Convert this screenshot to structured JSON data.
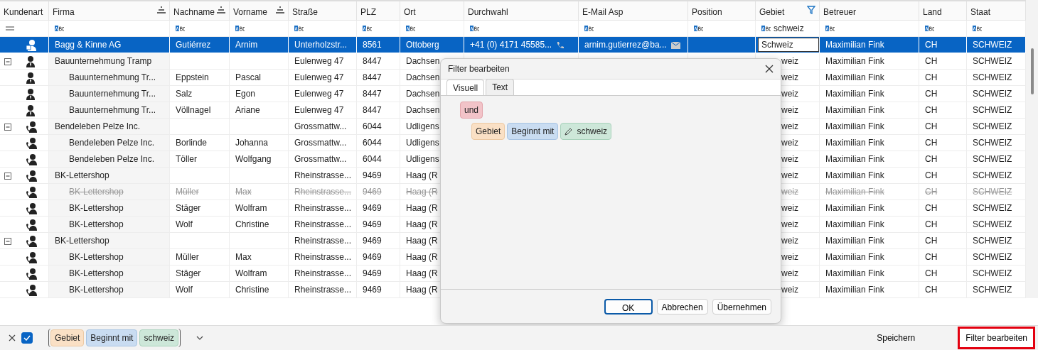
{
  "columns": [
    {
      "label": "Kundenart",
      "sorted": false,
      "filtered": false
    },
    {
      "label": "Firma",
      "sorted": true,
      "filtered": false
    },
    {
      "label": "Nachname",
      "sorted": true,
      "filtered": false
    },
    {
      "label": "Vorname",
      "sorted": true,
      "filtered": false
    },
    {
      "label": "Straße",
      "sorted": false,
      "filtered": false
    },
    {
      "label": "PLZ",
      "sorted": false,
      "filtered": false
    },
    {
      "label": "Ort",
      "sorted": false,
      "filtered": false
    },
    {
      "label": "Durchwahl",
      "sorted": false,
      "filtered": false
    },
    {
      "label": "E-Mail Asp",
      "sorted": false,
      "filtered": false
    },
    {
      "label": "Position",
      "sorted": false,
      "filtered": false
    },
    {
      "label": "Gebiet",
      "sorted": false,
      "filtered": true,
      "filter_text": "schweiz"
    },
    {
      "label": "Betreuer",
      "sorted": false,
      "filtered": false
    },
    {
      "label": "Land",
      "sorted": false,
      "filtered": false
    },
    {
      "label": "Staat",
      "sorted": false,
      "filtered": false
    }
  ],
  "rows": [
    {
      "kind": "company",
      "selected": true,
      "deleted": false,
      "firma": "Bagg & Kinne AG",
      "nachname": "Gutiérrez",
      "vorname": "Arnim",
      "strasse": "Unterholzstr...",
      "plz": "8561",
      "ort": "Ottoberg",
      "durchwahl": "+41 (0) 4171 45585...",
      "email": "arnim.gutierrez@ba...",
      "gebiet": "Schweiz",
      "betreuer": "Maximilian Fink",
      "land": "CH",
      "staat": "SCHWEIZ"
    },
    {
      "kind": "person",
      "selected": false,
      "deleted": false,
      "expanded": true,
      "firma": "Bauunternehmung Tramp",
      "strasse": "Eulenweg 47",
      "plz": "8447",
      "ort": "Dachsen",
      "gebiet": "weiz",
      "betreuer": "Maximilian Fink",
      "land": "CH",
      "staat": "SCHWEIZ",
      "children": [
        {
          "kind": "person",
          "selected": false,
          "deleted": false,
          "firma": "Bauunternehmung Tr...",
          "nachname": "Eppstein",
          "vorname": "Pascal",
          "strasse": "Eulenweg 47",
          "plz": "8447",
          "ort": "Dachsen",
          "gebiet": "weiz",
          "betreuer": "Maximilian Fink",
          "land": "CH",
          "staat": "SCHWEIZ"
        },
        {
          "kind": "person",
          "selected": false,
          "deleted": false,
          "firma": "Bauunternehmung Tr...",
          "nachname": "Salz",
          "vorname": "Egon",
          "strasse": "Eulenweg 47",
          "plz": "8447",
          "ort": "Dachsen",
          "gebiet": "weiz",
          "betreuer": "Maximilian Fink",
          "land": "CH",
          "staat": "SCHWEIZ"
        },
        {
          "kind": "person",
          "selected": false,
          "deleted": false,
          "firma": "Bauunternehmung Tr...",
          "nachname": "Völlnagel",
          "vorname": "Ariane",
          "strasse": "Eulenweg 47",
          "plz": "8447",
          "ort": "Dachsen",
          "gebiet": "weiz",
          "betreuer": "Maximilian Fink",
          "land": "CH",
          "staat": "SCHWEIZ"
        }
      ]
    },
    {
      "kind": "contact",
      "selected": false,
      "deleted": false,
      "expanded": true,
      "firma": "Bendeleben Pelze Inc.",
      "strasse": "Grossmattw...",
      "plz": "6044",
      "ort": "Udligens",
      "gebiet": "weiz",
      "betreuer": "Maximilian Fink",
      "land": "CH",
      "staat": "SCHWEIZ",
      "children": [
        {
          "kind": "contact",
          "selected": false,
          "deleted": false,
          "firma": "Bendeleben Pelze Inc.",
          "nachname": "Borlinde",
          "vorname": "Johanna",
          "strasse": "Grossmattw...",
          "plz": "6044",
          "ort": "Udligens",
          "gebiet": "weiz",
          "betreuer": "Maximilian Fink",
          "land": "CH",
          "staat": "SCHWEIZ"
        },
        {
          "kind": "contact",
          "selected": false,
          "deleted": false,
          "firma": "Bendeleben Pelze Inc.",
          "nachname": "Töller",
          "vorname": "Wolfgang",
          "strasse": "Grossmattw...",
          "plz": "6044",
          "ort": "Udligens",
          "gebiet": "weiz",
          "betreuer": "Maximilian Fink",
          "land": "CH",
          "staat": "SCHWEIZ"
        }
      ]
    },
    {
      "kind": "contact",
      "selected": false,
      "deleted": false,
      "expanded": true,
      "firma": "BK-Lettershop",
      "strasse": "Rheinstrasse...",
      "plz": "9469",
      "ort": "Haag (R",
      "gebiet": "weiz",
      "betreuer": "Maximilian Fink",
      "land": "CH",
      "staat": "SCHWEIZ",
      "children": [
        {
          "kind": "contact",
          "selected": false,
          "deleted": true,
          "firma": "BK-Lettershop",
          "nachname": "Müller",
          "vorname": "Max",
          "strasse": "Rheinstrasse...",
          "plz": "9469",
          "ort": "Haag (R",
          "gebiet": "weiz",
          "betreuer": "Maximilian Fink",
          "land": "CH",
          "staat": "SCHWEIZ"
        },
        {
          "kind": "contact",
          "selected": false,
          "deleted": false,
          "firma": "BK-Lettershop",
          "nachname": "Stäger",
          "vorname": "Wolfram",
          "strasse": "Rheinstrasse...",
          "plz": "9469",
          "ort": "Haag (R",
          "gebiet": "weiz",
          "betreuer": "Maximilian Fink",
          "land": "CH",
          "staat": "SCHWEIZ"
        },
        {
          "kind": "contact",
          "selected": false,
          "deleted": false,
          "firma": "BK-Lettershop",
          "nachname": "Wolf",
          "vorname": "Christine",
          "strasse": "Rheinstrasse...",
          "plz": "9469",
          "ort": "Haag (R",
          "gebiet": "weiz",
          "betreuer": "Maximilian Fink",
          "land": "CH",
          "staat": "SCHWEIZ"
        }
      ]
    },
    {
      "kind": "contact",
      "selected": false,
      "deleted": false,
      "expanded": true,
      "firma": "BK-Lettershop",
      "strasse": "Rheinstrasse...",
      "plz": "9469",
      "ort": "Haag (R",
      "gebiet": "weiz",
      "betreuer": "Maximilian Fink",
      "land": "CH",
      "staat": "SCHWEIZ",
      "children": [
        {
          "kind": "contact",
          "selected": false,
          "deleted": false,
          "firma": "BK-Lettershop",
          "nachname": "Müller",
          "vorname": "Max",
          "strasse": "Rheinstrasse...",
          "plz": "9469",
          "ort": "Haag (R",
          "gebiet": "weiz",
          "betreuer": "Maximilian Fink",
          "land": "CH",
          "staat": "SCHWEIZ"
        },
        {
          "kind": "contact",
          "selected": false,
          "deleted": false,
          "firma": "BK-Lettershop",
          "nachname": "Stäger",
          "vorname": "Wolfram",
          "strasse": "Rheinstrasse...",
          "plz": "9469",
          "ort": "Haag (R",
          "gebiet": "weiz",
          "betreuer": "Maximilian Fink",
          "land": "CH",
          "staat": "SCHWEIZ"
        },
        {
          "kind": "contact",
          "selected": false,
          "deleted": false,
          "firma": "BK-Lettershop",
          "nachname": "Wolf",
          "vorname": "Christine",
          "strasse": "Rheinstrasse...",
          "plz": "9469",
          "ort": "Haag (R",
          "gebiet": "weiz",
          "betreuer": "Maximilian Fink",
          "land": "CH",
          "staat": "SCHWEIZ"
        }
      ]
    }
  ],
  "dialog": {
    "title": "Filter bearbeiten",
    "tabs": [
      {
        "label": "Visuell",
        "selected": true
      },
      {
        "label": "Text",
        "selected": false
      }
    ],
    "operator": "und",
    "condition": {
      "field": "Gebiet",
      "op": "Beginnt mit",
      "value": "schweiz"
    },
    "buttons": [
      {
        "label": "OK",
        "default": true
      },
      {
        "label": "Abbrechen",
        "default": false
      },
      {
        "label": "Übernehmen",
        "default": false
      }
    ]
  },
  "filter_bar": {
    "enabled": true,
    "field": "Gebiet",
    "op": "Beginnt mit",
    "value": "schweiz",
    "save_label": "Speichern",
    "edit_label": "Filter bearbeiten",
    "edit_highlighted": true
  }
}
